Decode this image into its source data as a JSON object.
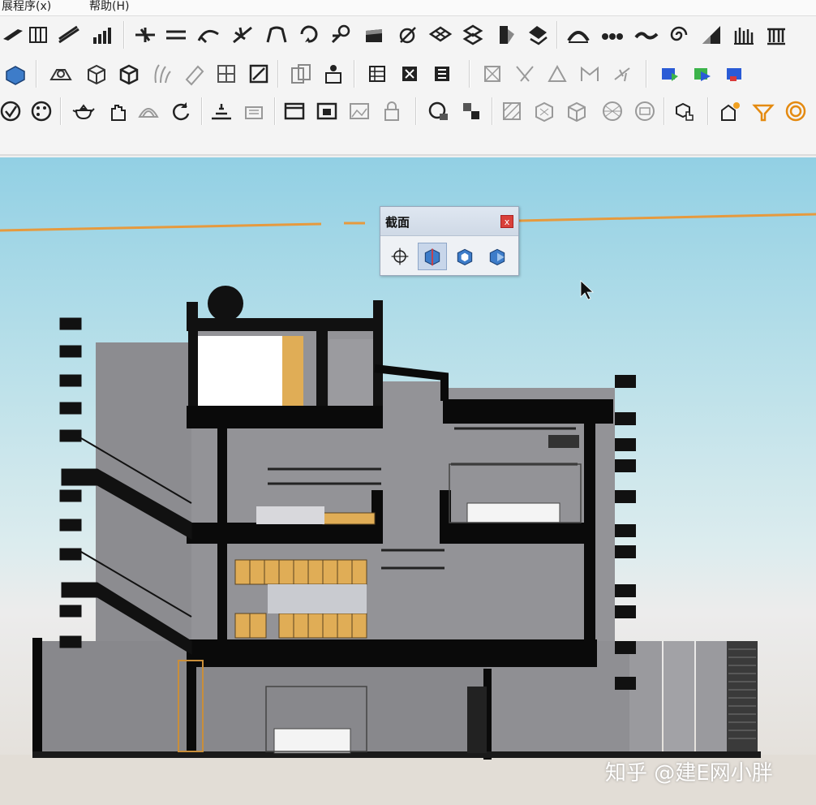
{
  "menu": {
    "items": [
      "展程序(x)",
      "帮助(H)"
    ]
  },
  "toolbars": {
    "row1_icons": [
      "roof-tool-icon",
      "wall-tool-icon",
      "stair-tool-icon",
      "bar-chart-icon",
      "line-split-icon",
      "offset-icon",
      "curve-tool-icon",
      "branch-tool-icon",
      "arc-tool-icon",
      "rotate-tool-icon",
      "follow-me-icon",
      "surface-icon",
      "edit-curve-icon",
      "mesh-icon",
      "transform-icon",
      "door-icon",
      "paint-icon",
      "arc-bridge-icon",
      "chain-icon",
      "wave-icon",
      "spiral-icon",
      "slope-icon",
      "grass-icon",
      "columns-icon"
    ],
    "row2_icons": [
      "cube-blue-icon",
      "section-view-icon",
      "box-icon",
      "box-edit-icon",
      "plant-icon",
      "pencil-icon",
      "grid-icon",
      "edit-box-icon",
      "copy-icon",
      "person-icon",
      "table-icon",
      "table-text-icon",
      "table-mold-icon",
      "star-outline-icon",
      "star-a-icon",
      "star-b-icon",
      "star-c-icon",
      "star-d-icon",
      "render-a-icon",
      "render-b-icon",
      "render-c-icon"
    ],
    "row3_icons": [
      "material-icon",
      "palette-icon",
      "teapot-icon",
      "hand-icon",
      "dome-icon",
      "refresh-icon",
      "terrain-icon",
      "sandbox-icon",
      "window-icon",
      "window-frame-icon",
      "image-icon",
      "lock-icon",
      "sphere-icon",
      "cube-move-icon",
      "texture-a-icon",
      "texture-b-icon",
      "texture-c-icon",
      "texture-d-icon",
      "texture-e-icon",
      "cube-hand-icon",
      "house-sun-icon",
      "filter-icon",
      "target-icon"
    ]
  },
  "section_panel": {
    "title": "截面",
    "close_label": "x",
    "buttons": [
      "section-plane-icon",
      "section-display-icon",
      "section-cut-icon",
      "section-fill-icon"
    ]
  },
  "watermark": "知乎 @建E网小胖",
  "colors": {
    "sky_top": "#92d0e4",
    "sky_bottom": "#dcecee",
    "ground": "#e2ddd6",
    "wall": "#8e8e92",
    "slab": "#0a0a0a",
    "wood": "#e0ad56",
    "horizon_line": "#e69a3e"
  }
}
